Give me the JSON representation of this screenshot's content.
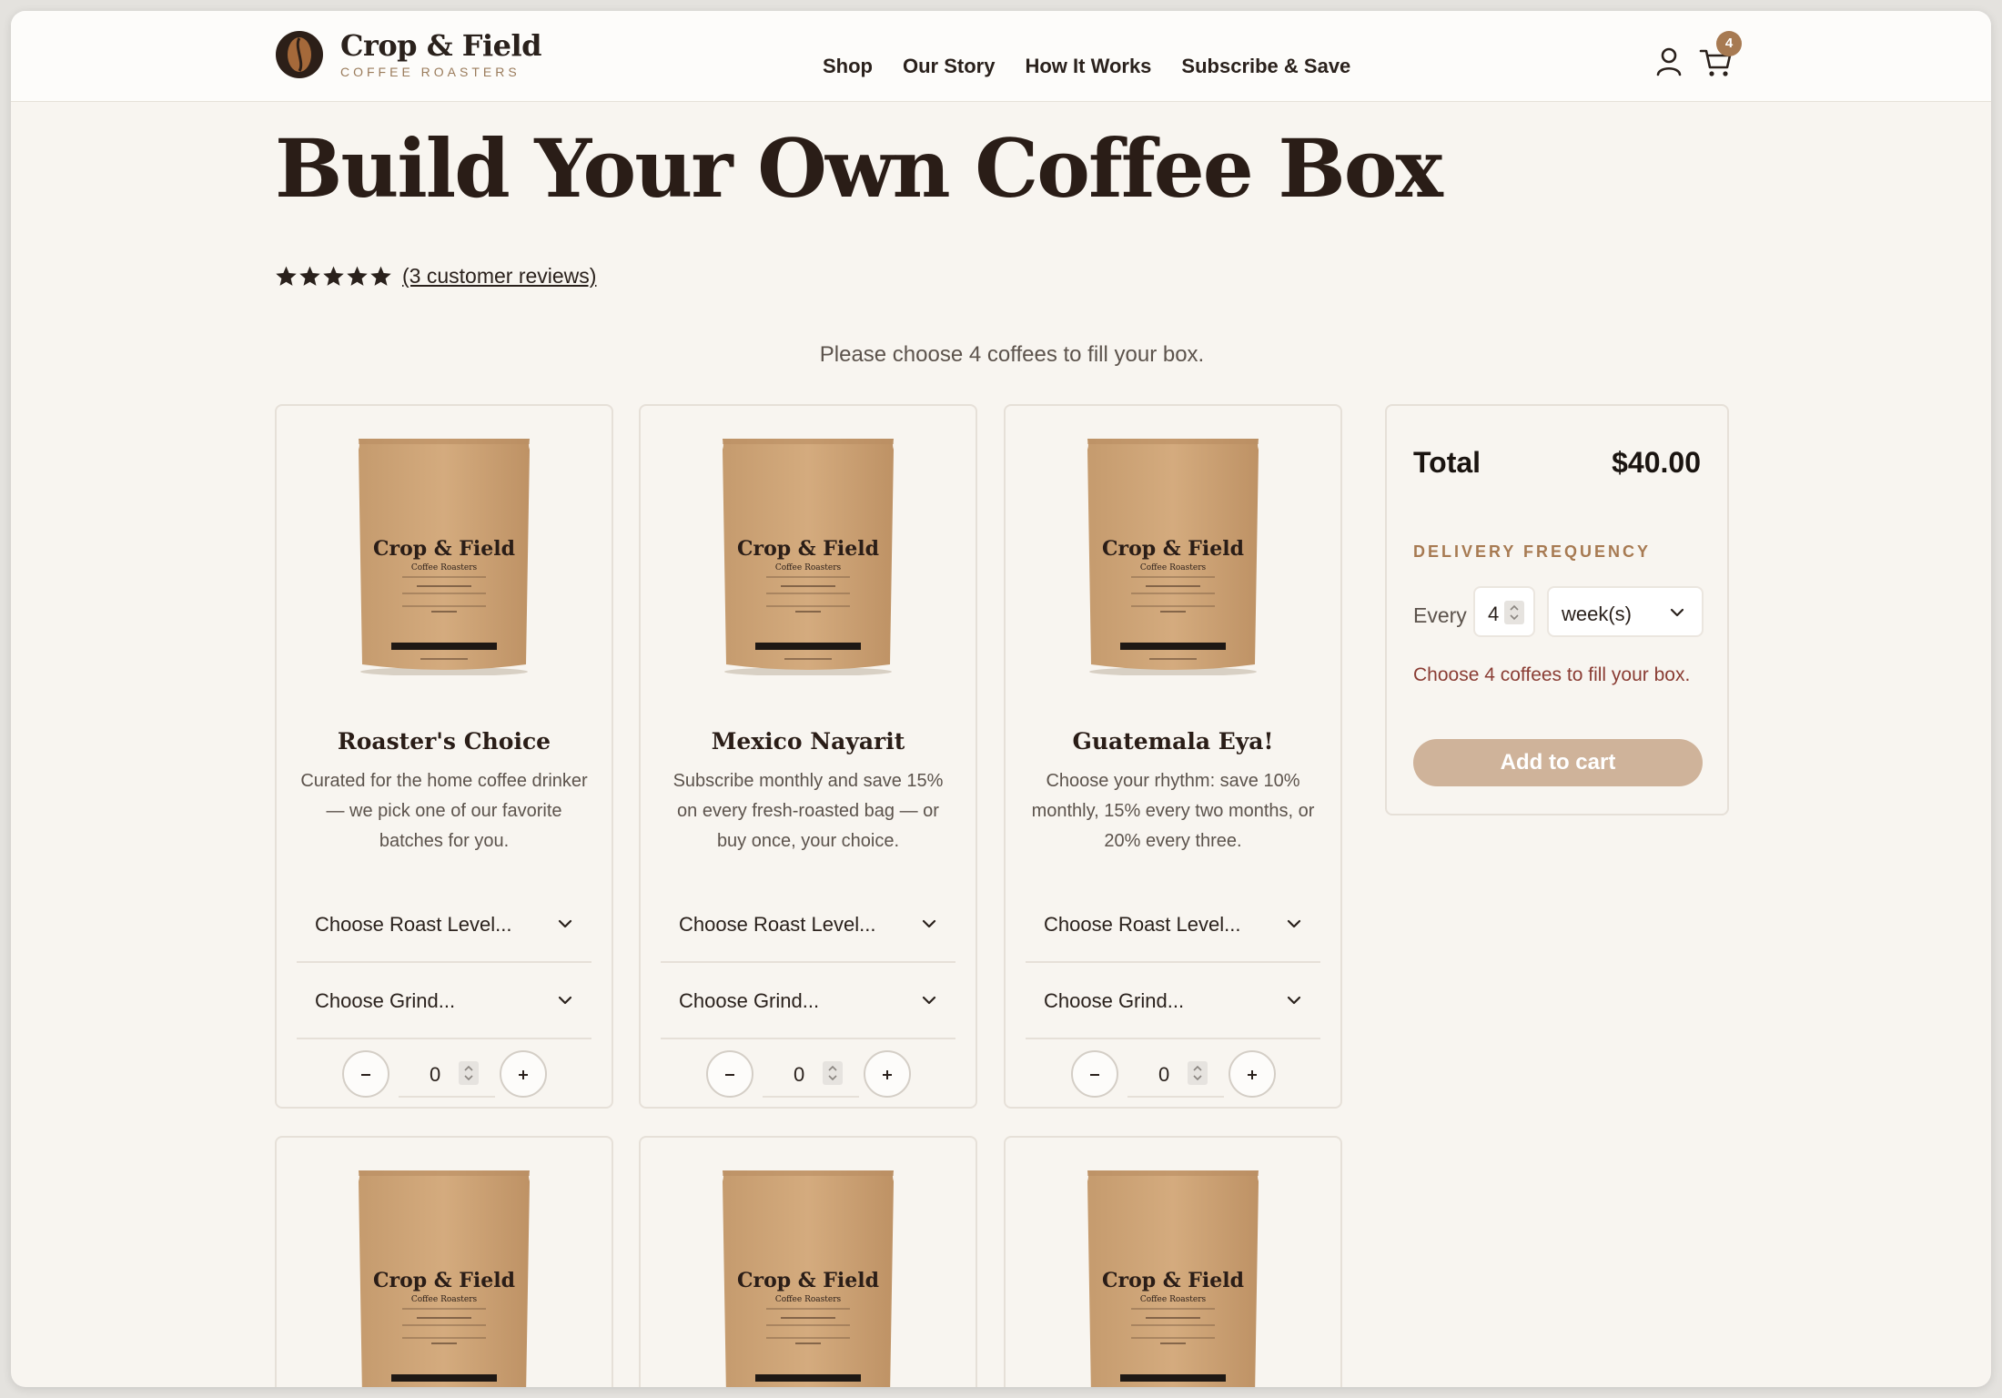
{
  "brand": {
    "name": "Crop & Field",
    "tagline": "COFFEE ROASTERS",
    "logo_icon": "coffee-bean-icon"
  },
  "nav": {
    "items": [
      "Shop",
      "Our Story",
      "How It Works",
      "Subscribe & Save"
    ]
  },
  "header": {
    "account_icon": "user-icon",
    "cart_icon": "cart-icon",
    "cart_count": "4"
  },
  "page": {
    "title": "Build Your Own Coffee Box",
    "rating_stars": 5,
    "reviews_link": "(3 customer reviews)",
    "instructions": "Please choose 4 coffees to fill your box."
  },
  "products": [
    {
      "name": "Roaster's Choice",
      "description": "Curated for the home coffee drinker — we pick one of our favorite batches for you.",
      "roast_placeholder": "Choose Roast Level...",
      "grind_placeholder": "Choose Grind...",
      "quantity": "0"
    },
    {
      "name": "Mexico Nayarit",
      "description": "Subscribe monthly and save 15% on every fresh-roasted bag — or buy once, your choice.",
      "roast_placeholder": "Choose Roast Level...",
      "grind_placeholder": "Choose Grind...",
      "quantity": "0"
    },
    {
      "name": "Guatemala Eya!",
      "description": "Choose your rhythm: save 10% monthly, 15% every two months, or 20% every three.",
      "roast_placeholder": "Choose Roast Level...",
      "grind_placeholder": "Choose Grind...",
      "quantity": "0"
    }
  ],
  "bag_label": {
    "brand": "Crop & Field",
    "sub": "Coffee Roasters"
  },
  "summary": {
    "total_label": "Total",
    "total_value": "$40.00",
    "frequency_label": "DELIVERY FREQUENCY",
    "every_label": "Every",
    "frequency_value": "4",
    "frequency_unit": "week(s)",
    "warning": "Choose 4 coffees to fill your box.",
    "add_to_cart": "Add to cart"
  },
  "colors": {
    "accent": "#a77a52",
    "background": "#f8f5f0",
    "button_disabled": "#cfb39a",
    "warning": "#8a3d34"
  }
}
